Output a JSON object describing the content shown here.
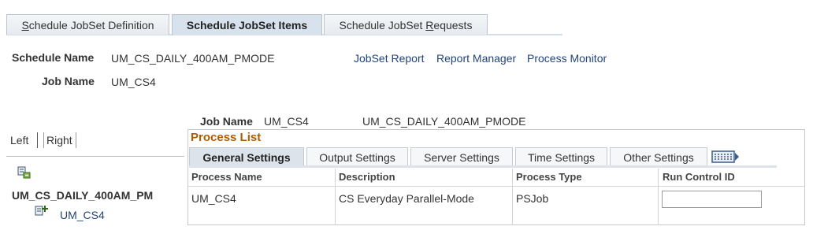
{
  "top_tabs": [
    {
      "pre": "",
      "u": "S",
      "post": "chedule JobSet Definition"
    },
    {
      "pre": "Schedule JobSet Items",
      "u": "",
      "post": ""
    },
    {
      "pre": "Schedule JobSet ",
      "u": "R",
      "post": "equests"
    }
  ],
  "header": {
    "schedule_name_label": "Schedule Name",
    "schedule_name_value": "UM_CS_DAILY_400AM_PMODE",
    "job_name_label": "Job Name",
    "job_name_value": "UM_CS4",
    "links": [
      "JobSet Report",
      "Report Manager",
      "Process Monitor"
    ]
  },
  "tree": {
    "left": "Left",
    "right": "Right",
    "root": "UM_CS_DAILY_400AM_PM",
    "child": "UM_CS4"
  },
  "detail": {
    "job_name_label": "Job Name",
    "job_name_value": "UM_CS4",
    "schedule_value": "UM_CS_DAILY_400AM_PMODE"
  },
  "process_list": {
    "title": "Process List",
    "tabs": [
      "General Settings",
      "Output Settings",
      "Server Settings",
      "Time Settings",
      "Other Settings"
    ],
    "columns": [
      "Process Name",
      "Description",
      "Process Type",
      "Run Control ID"
    ],
    "rows": [
      {
        "process_name": "UM_CS4",
        "description": "CS Everyday Parallel-Mode",
        "process_type": "PSJob",
        "run_control_id": ""
      }
    ]
  },
  "colors": {
    "link": "#22447a",
    "title": "#b25a00",
    "tab_active": "#d8e2ec"
  },
  "icons": [
    "tree-collapse-icon",
    "tree-node-icon",
    "show-all-columns-icon"
  ]
}
